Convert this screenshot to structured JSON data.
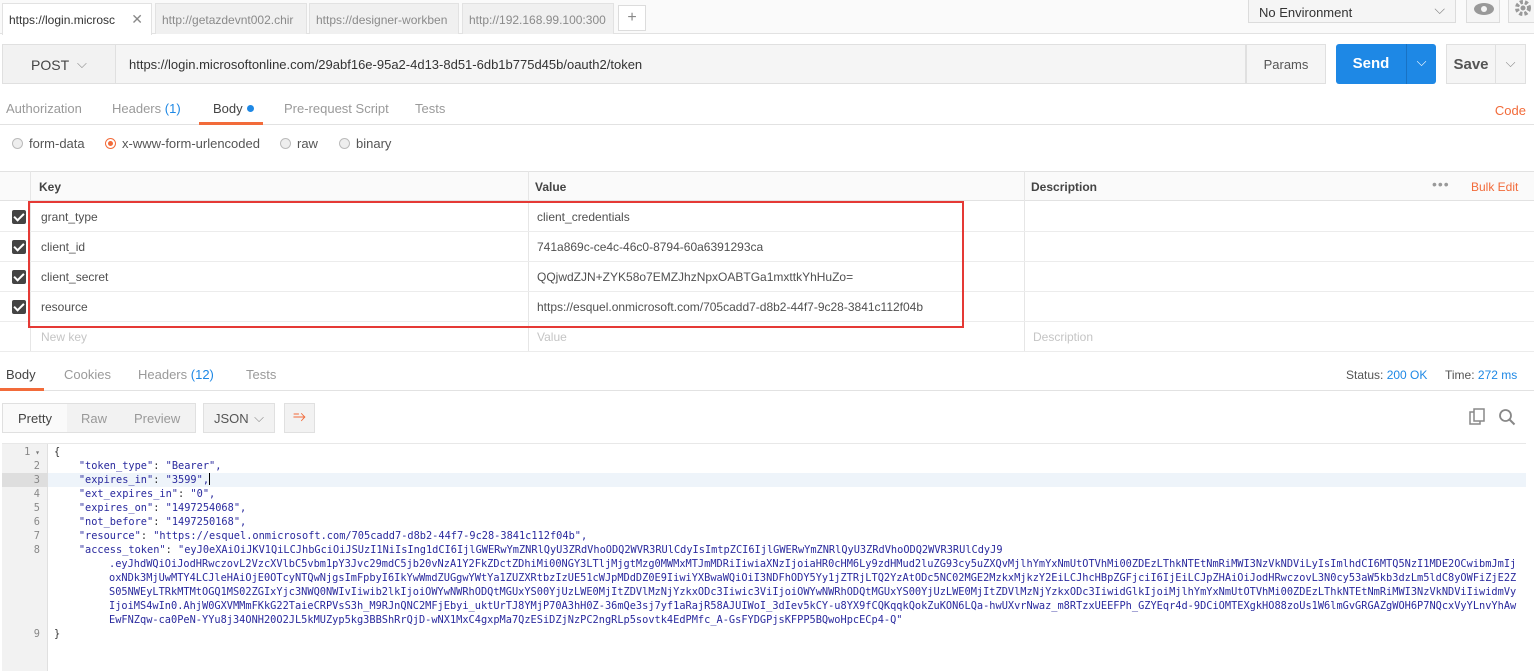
{
  "tabs": [
    {
      "label": "https://login.microsc",
      "active": true
    },
    {
      "label": "http://getazdevnt002.chir",
      "active": false
    },
    {
      "label": "https://designer-workben",
      "active": false
    },
    {
      "label": "http://192.168.99.100:300",
      "active": false
    }
  ],
  "environment": {
    "selected": "No Environment"
  },
  "request": {
    "method": "POST",
    "url": "https://login.microsoftonline.com/29abf16e-95a2-4d13-8d51-6db1b775d45b/oauth2/token",
    "params_label": "Params",
    "send_label": "Send",
    "save_label": "Save"
  },
  "request_tabs": {
    "authorization": "Authorization",
    "headers": "Headers",
    "headers_count": "(1)",
    "body": "Body",
    "prerequest": "Pre-request Script",
    "tests": "Tests",
    "code": "Code"
  },
  "body_types": {
    "form_data": "form-data",
    "urlencoded": "x-www-form-urlencoded",
    "raw": "raw",
    "binary": "binary",
    "selected": "x-www-form-urlencoded"
  },
  "kv_table": {
    "headers": {
      "key": "Key",
      "value": "Value",
      "description": "Description",
      "more": "•••",
      "bulk_edit": "Bulk Edit"
    },
    "rows": [
      {
        "key": "grant_type",
        "value": "client_credentials",
        "checked": true
      },
      {
        "key": "client_id",
        "value": "741a869c-ce4c-46c0-8794-60a6391293ca",
        "checked": true
      },
      {
        "key": "client_secret",
        "value": "QQjwdZJN+ZYK58o7EMZJhzNpxOABTGa1mxttkYhHuZo=",
        "checked": true
      },
      {
        "key": "resource",
        "value": "https://esquel.onmicrosoft.com/705cadd7-d8b2-44f7-9c28-3841c112f04b",
        "checked": true
      }
    ],
    "new_row": {
      "key_placeholder": "New key",
      "value_placeholder": "Value",
      "description_placeholder": "Description"
    }
  },
  "response_tabs": {
    "body": "Body",
    "cookies": "Cookies",
    "headers": "Headers",
    "headers_count": "(12)",
    "tests": "Tests",
    "status_label": "Status:",
    "status_value": "200 OK",
    "time_label": "Time:",
    "time_value": "272 ms"
  },
  "response_view": {
    "pretty": "Pretty",
    "raw": "Raw",
    "preview": "Preview",
    "format": "JSON"
  },
  "response_body": {
    "line_numbers": [
      "1",
      "2",
      "3",
      "4",
      "5",
      "6",
      "7",
      "8",
      "9"
    ],
    "open_brace": "{",
    "close_brace": "}",
    "fields": [
      {
        "key": "\"token_type\"",
        "value": "\"Bearer\","
      },
      {
        "key": "\"expires_in\"",
        "value": "\"3599\","
      },
      {
        "key": "\"ext_expires_in\"",
        "value": "\"0\","
      },
      {
        "key": "\"expires_on\"",
        "value": "\"1497254068\","
      },
      {
        "key": "\"not_before\"",
        "value": "\"1497250168\","
      },
      {
        "key": "\"resource\"",
        "value": "\"https://esquel.onmicrosoft.com/705cadd7-d8b2-44f7-9c28-3841c112f04b\","
      }
    ],
    "access_token_key": "\"access_token\"",
    "access_token_first": "\"eyJ0eXAiOiJKV1QiLCJhbGciOiJSUzI1NiIsIng1dCI6IjlGWERwYmZNRlQyU3ZRdVhoODQ2WVR3RUlCdyIsImtpZCI6IjlGWERwYmZNRlQyU3ZRdVhoODQ2WVR3RUlCdyJ9",
    "access_token_rest": ".eyJhdWQiOiJodHRwczovL2VzcXVlbC5vbm1pY3Jvc29mdC5jb20vNzA1Y2FkZDctZDhiMi00NGY3LTljMjgtMzg0MWMxMTJmMDRiIiwiaXNzIjoiaHR0cHM6Ly9zdHMud2luZG93cy5uZXQvMjlhYmYxNmUtOTVhMi00ZDEzLThkNTEtNmRiMWI3NzVkNDViLyIsImlhdCI6MTQ5NzI1MDE2OCwibmJmIjoxNDk3MjUwMTY4LCJleHAiOjE0OTcyNTQwNjgsImFpbyI6IkYwWmdZUGgwYWtYa1ZUZXRtbzIzUE51cWJpMDdDZ0E9IiwiYXBwaWQiOiI3NDFhODY5Yy1jZTRjLTQ2YzAtODc5NC02MGE2MzkxMjkzY2EiLCJhcHBpZGFjciI6IjEiLCJpZHAiOiJodHRwczovL3N0cy53aW5kb3dzLm5ldC8yOWFiZjE2ZS05NWEyLTRkMTMtOGQ1MS02ZGIxYjc3NWQ0NWIvIiwib2lkIjoiOWYwNWRhODQtMGUxYS00YjUzLWE0MjItZDVlMzNjYzkxODc3Iiwic3ViIjoiOWYwNWRhODQtMGUxYS00YjUzLWE0MjItZDVlMzNjYzkxODc3IiwidGlkIjoiMjlhYmYxNmUtOTVhMi00ZDEzLThkNTEtNmRiMWI3NzVkNDViIiwidmVyIjoiMS4wIn0.AhjW0GXVMMmFKkG22TaieCRPVsS3h_M9RJnQNC2MFjEbyi_uktUrTJ8YMjP70A3hH0Z-36mQe3sj7yf1aRajR58AJUIWoI_3dIev5kCY-u8YX9fCQKqqkQokZuKON6LQa-hwUXvrNwaz_m8RTzxUEEFPh_GZYEqr4d-9DCiOMTEXgkHO88zoUs1W6lmGvGRGAZgWOH6P7NQcxVyYLnvYhAwEwFNZqw-ca0PeN-YYu8j34ONH20O2JL5kMUZyp5kg3BBShRrQjD-wNX1MxC4gxpMa7QzESiDZjNzPC2ngRLp5sovtk4EdPMfc_A-GsFYDGPjsKFPP5BQwoHpcECp4-Q\""
  },
  "colors": {
    "accent": "#f26b3a",
    "primary": "#1e88e5",
    "highlight": "#e53935"
  }
}
